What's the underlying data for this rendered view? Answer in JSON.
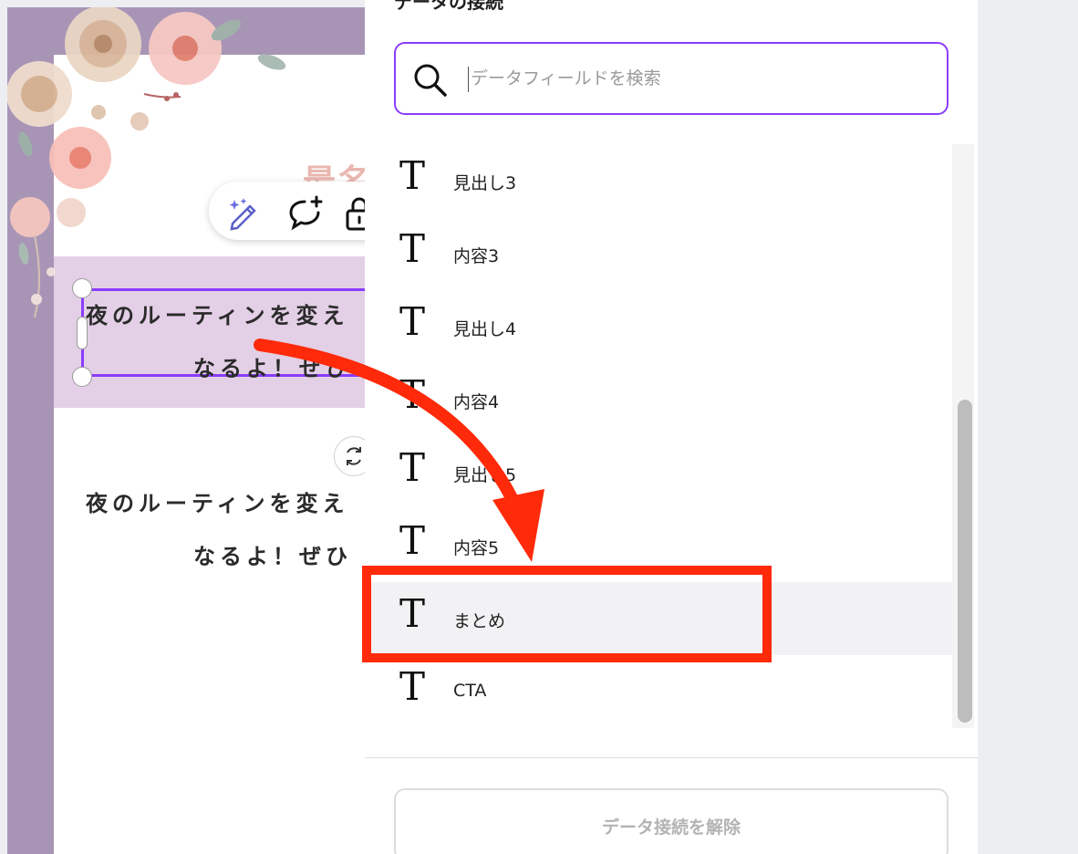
{
  "canvas": {
    "heading_fragment": "最名",
    "selected_text": {
      "line1": "夜のルーティンを変え",
      "line2": "なるよ！ぜひ"
    },
    "body_text": {
      "line1": "夜のルーティンを変え",
      "line2": "なるよ！ぜひ"
    },
    "colors": {
      "frame": "#a895b6",
      "band": "#e3cfe6",
      "selection": "#8b3dff"
    }
  },
  "toolbar": {
    "icons": [
      "magic-edit-icon",
      "add-comment-icon",
      "lock-icon"
    ]
  },
  "panel": {
    "title": "データの接続",
    "search": {
      "placeholder": "データフィールドを検索",
      "value": ""
    },
    "fields": [
      {
        "label": "見出し3",
        "icon": "text-field-icon"
      },
      {
        "label": "内容3",
        "icon": "text-field-icon"
      },
      {
        "label": "見出し4",
        "icon": "text-field-icon"
      },
      {
        "label": "内容4",
        "icon": "text-field-icon"
      },
      {
        "label": "見出し5",
        "icon": "text-field-icon"
      },
      {
        "label": "内容5",
        "icon": "text-field-icon"
      },
      {
        "label": "まとめ",
        "icon": "text-field-icon",
        "highlighted": true
      },
      {
        "label": "CTA",
        "icon": "text-field-icon"
      }
    ],
    "disconnect_label": "データ接続を解除"
  },
  "annotation": {
    "color": "#ff2a0a",
    "target": "まとめ"
  }
}
